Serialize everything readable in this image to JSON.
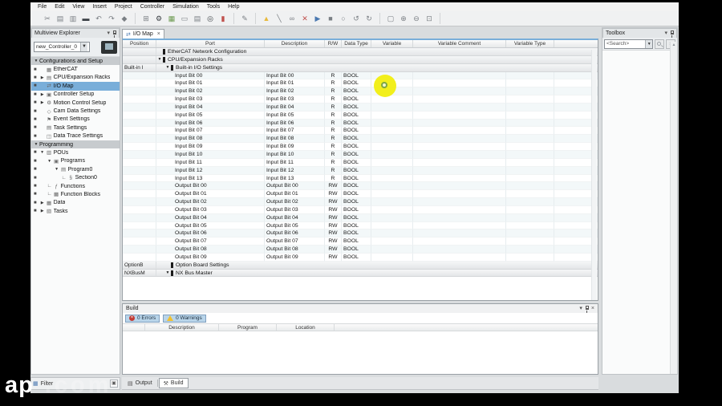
{
  "menu": {
    "items": [
      "File",
      "Edit",
      "View",
      "Insert",
      "Project",
      "Controller",
      "Simulation",
      "Tools",
      "Help"
    ]
  },
  "toolbar": {
    "groups": [
      [
        "cut",
        "copy",
        "paste",
        "delete",
        "undo",
        "redo",
        "reference"
      ],
      [
        "window",
        "wrench",
        "variables",
        "monitor",
        "memory",
        "search",
        "library"
      ],
      [
        "edit-mode"
      ],
      [
        "warning",
        "draw-line",
        "watch",
        "breakpoint",
        "pointer",
        "block",
        "circle",
        "sync-back",
        "sync-forward"
      ],
      [
        "frame",
        "zoom-in",
        "zoom-out",
        "zoom-fit"
      ]
    ]
  },
  "multiview": {
    "title": "Multiview Explorer",
    "controller": "new_Controller_0",
    "filter_label": "Filter",
    "tree": [
      {
        "kind": "section",
        "label": "Configurations and Setup"
      },
      {
        "kind": "item",
        "label": "EtherCAT",
        "indent": 1,
        "icon": "ethercat-icon"
      },
      {
        "kind": "item",
        "label": "CPU/Expansion Racks",
        "indent": 1,
        "arrow": "right",
        "icon": "rack-icon"
      },
      {
        "kind": "item",
        "label": "I/O Map",
        "indent": 1,
        "icon": "iomap-icon",
        "selected": true
      },
      {
        "kind": "item",
        "label": "Controller Setup",
        "indent": 1,
        "arrow": "right",
        "icon": "controller-icon"
      },
      {
        "kind": "item",
        "label": "Motion Control Setup",
        "indent": 1,
        "arrow": "right",
        "icon": "gear-icon"
      },
      {
        "kind": "item",
        "label": "Cam Data Settings",
        "indent": 1,
        "icon": "cam-icon"
      },
      {
        "kind": "item",
        "label": "Event Settings",
        "indent": 1,
        "icon": "flag-icon"
      },
      {
        "kind": "item",
        "label": "Task Settings",
        "indent": 1,
        "icon": "task-icon"
      },
      {
        "kind": "item",
        "label": "Data Trace Settings",
        "indent": 1,
        "icon": "trace-icon"
      },
      {
        "kind": "section",
        "label": "Programming"
      },
      {
        "kind": "item",
        "label": "POUs",
        "indent": 1,
        "arrow": "down",
        "icon": "pou-icon"
      },
      {
        "kind": "item",
        "label": "Programs",
        "indent": 2,
        "arrow": "down",
        "icon": "programs-icon"
      },
      {
        "kind": "item",
        "label": "Program0",
        "indent": 3,
        "arrow": "down",
        "icon": "program-icon"
      },
      {
        "kind": "item",
        "label": "Section0",
        "indent": 4,
        "prefix": "L",
        "icon": "section-icon"
      },
      {
        "kind": "item",
        "label": "Functions",
        "indent": 2,
        "prefix": "L",
        "icon": "function-icon"
      },
      {
        "kind": "item",
        "label": "Function Blocks",
        "indent": 2,
        "prefix": "L",
        "icon": "fb-icon"
      },
      {
        "kind": "item",
        "label": "Data",
        "indent": 1,
        "arrow": "right",
        "icon": "data-icon"
      },
      {
        "kind": "item",
        "label": "Tasks",
        "indent": 1,
        "arrow": "right",
        "icon": "tasks-icon"
      }
    ]
  },
  "io_map": {
    "tab": "I/O Map",
    "columns": [
      "Position",
      "Port",
      "Description",
      "R/W",
      "Data Type",
      "Variable",
      "Variable Comment",
      "Variable Type",
      ""
    ],
    "rows": [
      {
        "kind": "group",
        "level": 0,
        "arrow": false,
        "position": "",
        "label": "EtherCAT Network Configuration"
      },
      {
        "kind": "group",
        "level": 0,
        "arrow": true,
        "position": "",
        "label": "CPU/Expansion Racks"
      },
      {
        "kind": "group",
        "level": 1,
        "arrow": true,
        "position": "Built-in I",
        "label": "Built-in I/O Settings"
      },
      {
        "kind": "data",
        "port": "Input Bit 00",
        "description": "Input Bit 00",
        "rw": "R",
        "data_type": "BOOL"
      },
      {
        "kind": "data",
        "port": "Input Bit 01",
        "description": "Input Bit 01",
        "rw": "R",
        "data_type": "BOOL"
      },
      {
        "kind": "data",
        "port": "Input Bit 02",
        "description": "Input Bit 02",
        "rw": "R",
        "data_type": "BOOL"
      },
      {
        "kind": "data",
        "port": "Input Bit 03",
        "description": "Input Bit 03",
        "rw": "R",
        "data_type": "BOOL"
      },
      {
        "kind": "data",
        "port": "Input Bit 04",
        "description": "Input Bit 04",
        "rw": "R",
        "data_type": "BOOL"
      },
      {
        "kind": "data",
        "port": "Input Bit 05",
        "description": "Input Bit 05",
        "rw": "R",
        "data_type": "BOOL"
      },
      {
        "kind": "data",
        "port": "Input Bit 06",
        "description": "Input Bit 06",
        "rw": "R",
        "data_type": "BOOL"
      },
      {
        "kind": "data",
        "port": "Input Bit 07",
        "description": "Input Bit 07",
        "rw": "R",
        "data_type": "BOOL"
      },
      {
        "kind": "data",
        "port": "Input Bit 08",
        "description": "Input Bit 08",
        "rw": "R",
        "data_type": "BOOL"
      },
      {
        "kind": "data",
        "port": "Input Bit 09",
        "description": "Input Bit 09",
        "rw": "R",
        "data_type": "BOOL"
      },
      {
        "kind": "data",
        "port": "Input Bit 10",
        "description": "Input Bit 10",
        "rw": "R",
        "data_type": "BOOL"
      },
      {
        "kind": "data",
        "port": "Input Bit 11",
        "description": "Input Bit 11",
        "rw": "R",
        "data_type": "BOOL"
      },
      {
        "kind": "data",
        "port": "Input Bit 12",
        "description": "Input Bit 12",
        "rw": "R",
        "data_type": "BOOL"
      },
      {
        "kind": "data",
        "port": "Input Bit 13",
        "description": "Input Bit 13",
        "rw": "R",
        "data_type": "BOOL"
      },
      {
        "kind": "data",
        "port": "Output Bit 00",
        "description": "Output Bit 00",
        "rw": "RW",
        "data_type": "BOOL"
      },
      {
        "kind": "data",
        "port": "Output Bit 01",
        "description": "Output Bit 01",
        "rw": "RW",
        "data_type": "BOOL"
      },
      {
        "kind": "data",
        "port": "Output Bit 02",
        "description": "Output Bit 02",
        "rw": "RW",
        "data_type": "BOOL"
      },
      {
        "kind": "data",
        "port": "Output Bit 03",
        "description": "Output Bit 03",
        "rw": "RW",
        "data_type": "BOOL"
      },
      {
        "kind": "data",
        "port": "Output Bit 04",
        "description": "Output Bit 04",
        "rw": "RW",
        "data_type": "BOOL"
      },
      {
        "kind": "data",
        "port": "Output Bit 05",
        "description": "Output Bit 05",
        "rw": "RW",
        "data_type": "BOOL"
      },
      {
        "kind": "data",
        "port": "Output Bit 06",
        "description": "Output Bit 06",
        "rw": "RW",
        "data_type": "BOOL"
      },
      {
        "kind": "data",
        "port": "Output Bit 07",
        "description": "Output Bit 07",
        "rw": "RW",
        "data_type": "BOOL"
      },
      {
        "kind": "data",
        "port": "Output Bit 08",
        "description": "Output Bit 08",
        "rw": "RW",
        "data_type": "BOOL"
      },
      {
        "kind": "data",
        "port": "Output Bit 09",
        "description": "Output Bit 09",
        "rw": "RW",
        "data_type": "BOOL"
      },
      {
        "kind": "group",
        "level": 1,
        "arrow": false,
        "position": "OptionB",
        "label": "Option Board Settings"
      },
      {
        "kind": "group",
        "level": 1,
        "arrow": true,
        "position": "NXBusM",
        "label": "NX Bus Master"
      }
    ]
  },
  "build": {
    "title": "Build",
    "errors_label": "0  Errors",
    "warnings_label": "0  Warnings",
    "columns": [
      "",
      "Description",
      "Program",
      "Location",
      ""
    ]
  },
  "bottom_tabs": {
    "output": "Output",
    "build": "Build"
  },
  "toolbox": {
    "title": "Toolbox",
    "search": "<Search>"
  },
  "watermark": {
    "bold": "ap",
    "faint": ".com"
  }
}
